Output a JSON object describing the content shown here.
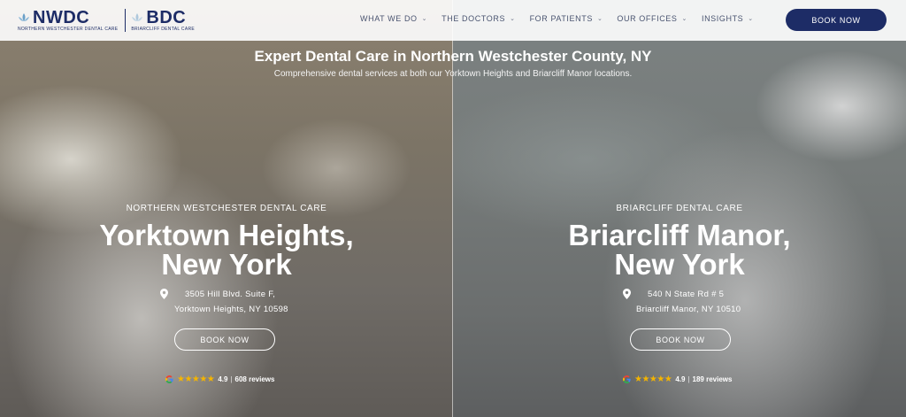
{
  "header": {
    "logo_nwdc": "NWDC",
    "logo_nwdc_sub": "NORTHERN WESTCHESTER DENTAL CARE",
    "logo_bdc": "BDC",
    "logo_bdc_sub": "BRIARCLIFF DENTAL CARE",
    "nav": [
      {
        "label": "WHAT WE DO",
        "icon": "chevron-down"
      },
      {
        "label": "THE DOCTORS",
        "icon": "chevron-down"
      },
      {
        "label": "FOR PATIENTS",
        "icon": "chevron-down"
      },
      {
        "label": "OUR OFFICES",
        "icon": "chevron-down"
      },
      {
        "label": "INSIGHTS",
        "icon": "chevron-down"
      }
    ],
    "book_label": "BOOK NOW",
    "accent_color": "#1d2c66"
  },
  "hero": {
    "title": "Expert Dental Care in Northern Westchester County, NY",
    "subtitle": "Comprehensive dental services at both our Yorktown Heights and Briarcliff Manor locations."
  },
  "locations": [
    {
      "practice": "NORTHERN WESTCHESTER DENTAL CARE",
      "name_line1": "Yorktown Heights,",
      "name_line2": "New York",
      "address_line1": "3505 Hill Blvd. Suite F,",
      "address_line2": "Yorktown Heights, NY 10598",
      "book_label": "BOOK NOW",
      "rating_stars": "★★★★★",
      "rating_score": "4.9",
      "rating_sep": "|",
      "rating_reviews": "608 reviews"
    },
    {
      "practice": "BRIARCLIFF DENTAL CARE",
      "name_line1": "Briarcliff Manor,",
      "name_line2": "New York",
      "address_line1": "540 N State Rd # 5",
      "address_line2": "Briarcliff Manor, NY 10510",
      "book_label": "BOOK NOW",
      "rating_stars": "★★★★★",
      "rating_score": "4.9",
      "rating_sep": "|",
      "rating_reviews": "189 reviews"
    }
  ]
}
